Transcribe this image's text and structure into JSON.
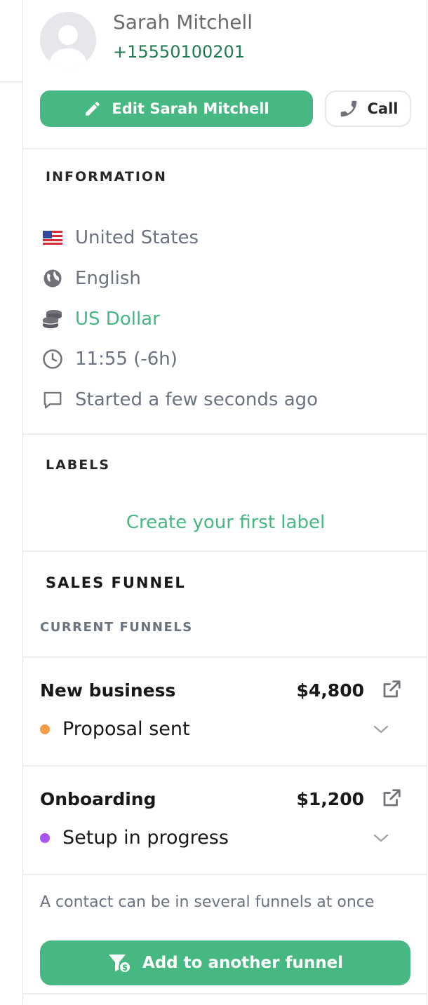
{
  "contact": {
    "name": "Sarah Mitchell",
    "phone": "+15550100201",
    "avatar_icon": "user-placeholder-icon"
  },
  "actions": {
    "edit_label": "Edit Sarah Mitchell",
    "call_label": "Call"
  },
  "information": {
    "title": "INFORMATION",
    "country": "United States",
    "language": "English",
    "currency": "US Dollar",
    "local_time": "11:55 (-6h)",
    "conversation": "Started a few seconds ago"
  },
  "labels": {
    "title": "LABELS",
    "create_link": "Create your first label"
  },
  "sales_funnel": {
    "title": "SALES FUNNEL",
    "current_title": "CURRENT FUNNELS",
    "funnels": [
      {
        "name": "New business",
        "amount": "$4,800",
        "stage": "Proposal sent",
        "stage_color": "#f59b42"
      },
      {
        "name": "Onboarding",
        "amount": "$1,200",
        "stage": "Setup in progress",
        "stage_color": "#a855f7"
      }
    ],
    "hint": "A contact can be in several funnels at once",
    "add_label": "Add to another funnel"
  },
  "colors": {
    "accent": "#47b881",
    "phone": "#1f7a4f",
    "border": "#ededef"
  }
}
